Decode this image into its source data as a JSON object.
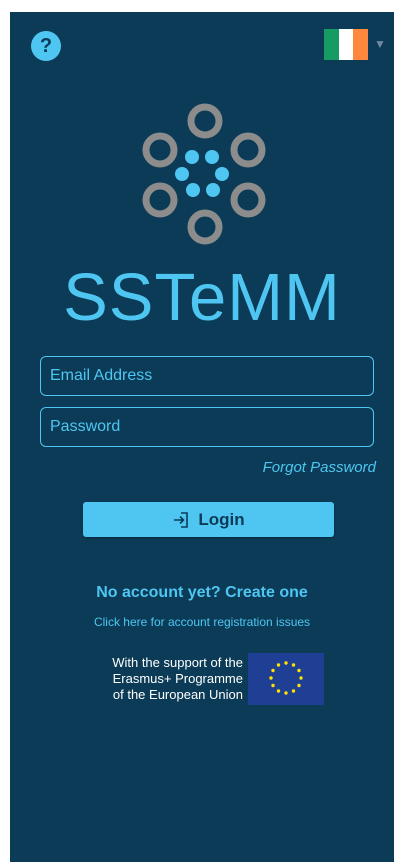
{
  "header": {
    "help_label": "?",
    "language_flag": {
      "name": "ireland-flag-icon",
      "colors": [
        "#169b62",
        "#ffffff",
        "#ff883e"
      ]
    }
  },
  "brand": {
    "name": "SSTeMM",
    "logo_icon": "sstemm-logo-icon",
    "colors": {
      "accent": "#4fc6f2",
      "ring": "#8c8c8c",
      "background": "#0b3b56"
    }
  },
  "form": {
    "email_placeholder": "Email Address",
    "password_placeholder": "Password",
    "forgot_label": "Forgot Password",
    "login_label": "Login",
    "login_icon": "login-arrow-icon"
  },
  "links": {
    "create_account": "No account yet? Create one",
    "registration_issues": "Click here for account registration issues"
  },
  "support": {
    "lines": [
      "With the support of the",
      "Erasmus+ Programme",
      "of the European Union"
    ],
    "flag_icon": "eu-flag-icon"
  }
}
